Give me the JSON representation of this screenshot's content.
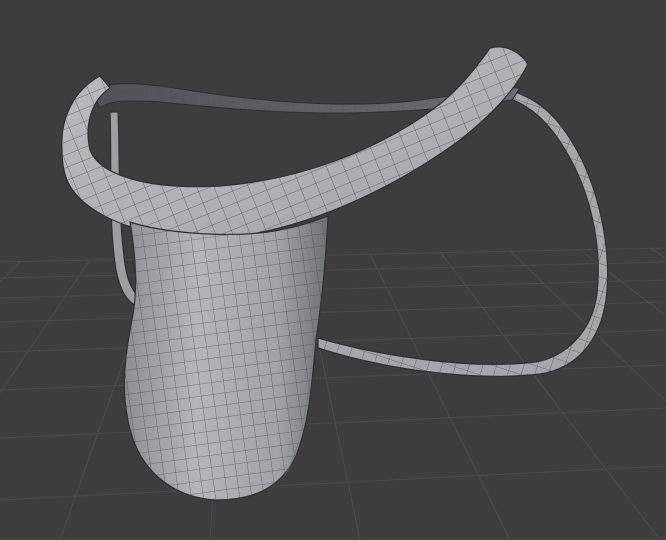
{
  "viewport": {
    "background_color": "#3d3d3d",
    "grid_color": "#4a4a4a",
    "grid_highlight_color": "#555555",
    "mesh_fill_color": "#a9abad",
    "mesh_shade_color": "#7e8082",
    "wire_color": "#2f2f2f"
  },
  "object": {
    "type": "mesh",
    "shading": "solid",
    "overlay": "wireframe"
  }
}
